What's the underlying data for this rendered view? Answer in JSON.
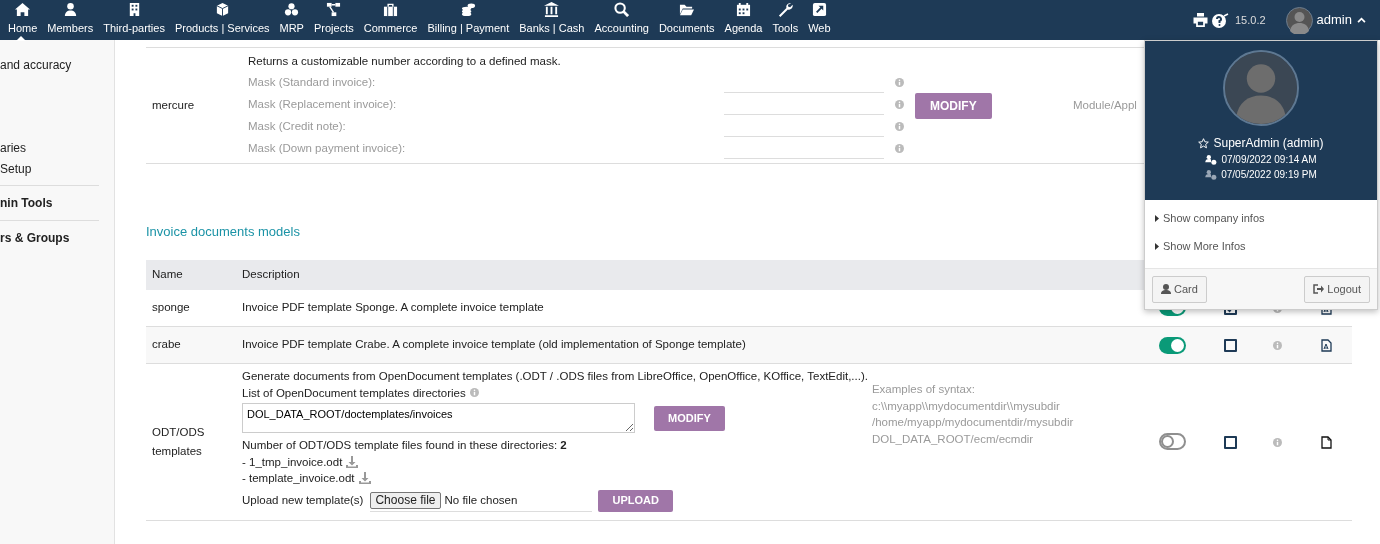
{
  "topnav": {
    "items": [
      {
        "label": "Home",
        "selected": true
      },
      {
        "label": "Members",
        "selected": false
      },
      {
        "label": "Third-parties",
        "selected": false
      },
      {
        "label": "Products | Services",
        "selected": false
      },
      {
        "label": "MRP",
        "selected": false
      },
      {
        "label": "Projects",
        "selected": false
      },
      {
        "label": "Commerce",
        "selected": false
      },
      {
        "label": "Billing | Payment",
        "selected": false
      },
      {
        "label": "Banks | Cash",
        "selected": false
      },
      {
        "label": "Accounting",
        "selected": false
      },
      {
        "label": "Documents",
        "selected": false
      },
      {
        "label": "Agenda",
        "selected": false
      },
      {
        "label": "Tools",
        "selected": false
      },
      {
        "label": "Web",
        "selected": false
      }
    ],
    "version": "15.0.2",
    "user": "admin"
  },
  "sidebar": {
    "items": [
      {
        "label": "and accuracy",
        "kind": "link"
      },
      {
        "label": "aries",
        "kind": "link"
      },
      {
        "label": "Setup",
        "kind": "link"
      },
      {
        "label": "nin Tools",
        "kind": "heading"
      },
      {
        "label": "rs & Groups",
        "kind": "heading"
      }
    ]
  },
  "numbering_row": {
    "name": "mercure",
    "description": "Returns a customizable number according to a defined mask.",
    "fields": [
      {
        "label": "Mask (Standard invoice):"
      },
      {
        "label": "Mask (Replacement invoice):"
      },
      {
        "label": "Mask (Credit note):"
      },
      {
        "label": "Mask (Down payment invoice):"
      }
    ],
    "button": "MODIFY",
    "note": "Module/Appl"
  },
  "section_title": "Invoice documents models",
  "models_table": {
    "columns": [
      "Name",
      "Description"
    ],
    "rows": [
      {
        "kind": "simple",
        "name": "sponge",
        "description": "Invoice PDF template Sponge. A complete invoice template",
        "on": true,
        "default": true
      },
      {
        "kind": "simple",
        "name": "crabe",
        "description": "Invoice PDF template Crabe. A complete invoice template (old implementation of Sponge template)",
        "on": true,
        "default": false
      },
      {
        "kind": "odt",
        "name": "ODT/ODS templates",
        "description": "Generate documents from OpenDocument templates (.ODT / .ODS files from LibreOffice, OpenOffice, KOffice, TextEdit,...).",
        "directories_label": "List of OpenDocument templates directories",
        "directories_value": "DOL_DATA_ROOT/doctemplates/invoices",
        "modify_button": "MODIFY",
        "found_text": "Number of ODT/ODS template files found in these directories: **2**",
        "files": [
          "- 1_tmp_invoice.odt",
          "- template_invoice.odt"
        ],
        "upload_label": "Upload new template(s)",
        "choose_button": "Choose file",
        "no_file": "No file chosen",
        "upload_button": "UPLOAD",
        "syntax_lines": [
          "Examples of syntax:",
          "c:\\\\myapp\\\\mydocumentdir\\\\mysubdir",
          "/home/myapp/mydocumentdir/mysubdir",
          "DOL_DATA_ROOT/ecm/ecmdir"
        ],
        "on": false,
        "default": false
      }
    ]
  },
  "user_menu": {
    "name": "SuperAdmin (admin)",
    "last_login": "07/09/2022 09:14 AM",
    "previous_login": "07/05/2022 09:19 PM",
    "links": [
      "Show company infos",
      "Show More Infos"
    ],
    "buttons": [
      {
        "label": "Card",
        "kind": "card"
      },
      {
        "label": "Logout",
        "kind": "logout"
      }
    ]
  }
}
